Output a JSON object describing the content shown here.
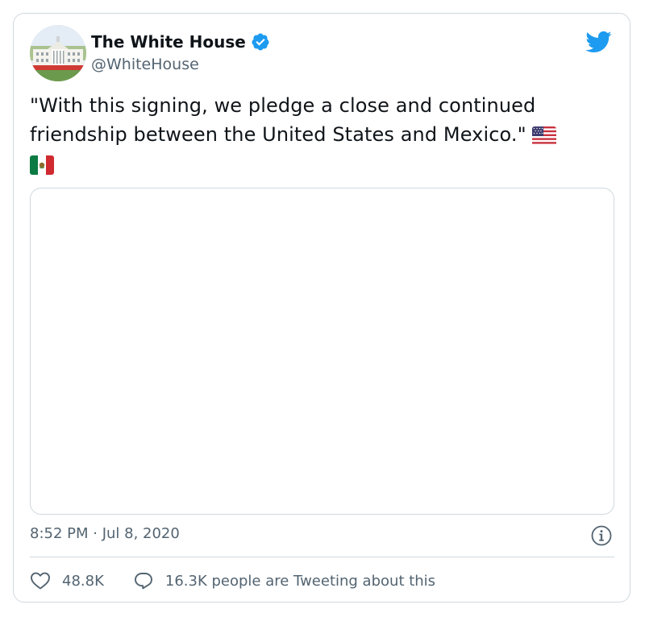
{
  "author": {
    "name": "The White House",
    "handle": "@WhiteHouse",
    "verified": true
  },
  "tweet": {
    "text": "\"With this signing, we pledge a close and continued friendship between the United States and Mexico.\"",
    "flags": [
      "us-flag",
      "mexico-flag"
    ]
  },
  "meta": {
    "timestamp": "8:52 PM · Jul 8, 2020"
  },
  "actions": {
    "likes": "48.8K",
    "conversation": "16.3K people are Tweeting about this"
  },
  "colors": {
    "brand": "#1d9bf0",
    "muted": "#536471",
    "border": "#cfd9de"
  }
}
